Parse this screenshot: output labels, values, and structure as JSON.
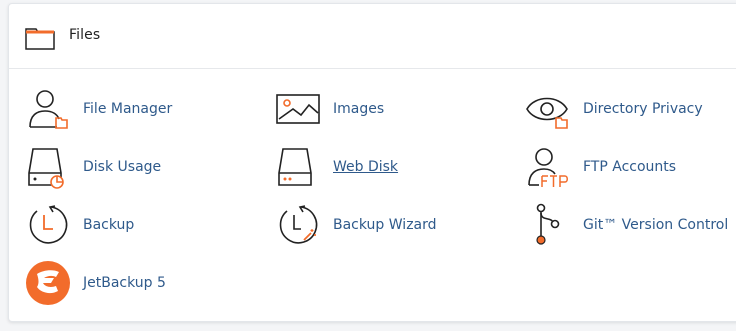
{
  "section": {
    "title": "Files",
    "icon": "folder-icon"
  },
  "colors": {
    "accent": "#f26c2b",
    "link": "#2f5a8b",
    "icon_stroke": "#222222"
  },
  "items": [
    {
      "label": "File Manager",
      "icon": "file-manager-icon"
    },
    {
      "label": "Images",
      "icon": "images-icon"
    },
    {
      "label": "Directory Privacy",
      "icon": "directory-privacy-icon"
    },
    {
      "label": "Disk Usage",
      "icon": "disk-usage-icon"
    },
    {
      "label": "Web Disk",
      "icon": "web-disk-icon"
    },
    {
      "label": "FTP Accounts",
      "icon": "ftp-accounts-icon"
    },
    {
      "label": "Backup",
      "icon": "backup-icon"
    },
    {
      "label": "Backup Wizard",
      "icon": "backup-wizard-icon"
    },
    {
      "label": "Git™ Version Control",
      "icon": "git-icon"
    },
    {
      "label": "JetBackup 5",
      "icon": "jetbackup-icon"
    }
  ]
}
